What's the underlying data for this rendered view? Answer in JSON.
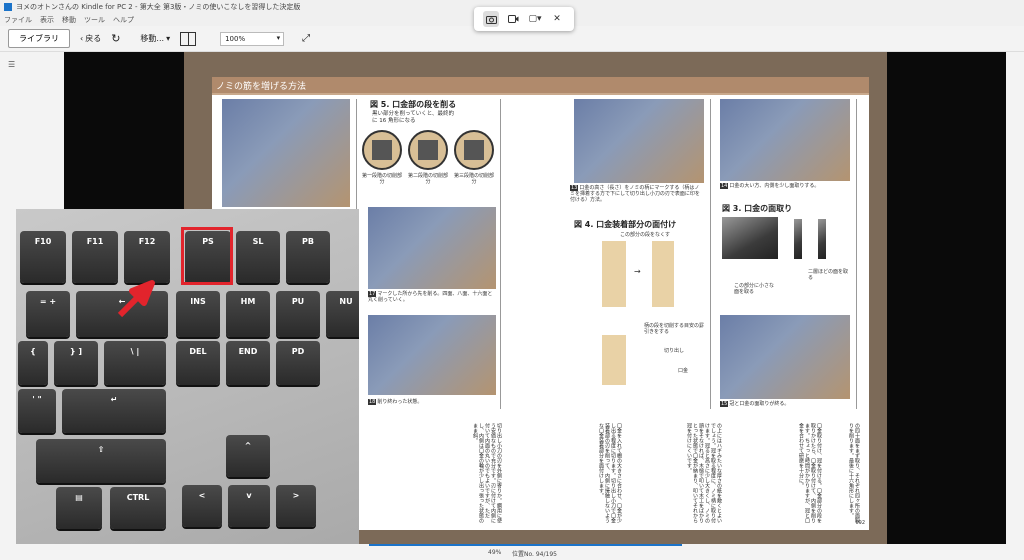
{
  "window": {
    "title": "ヨメのオトンさんの Kindle for PC 2 - 第大全 第3版・ノミの使いこなしを習得した決定版"
  },
  "menu": [
    "ファイル",
    "表示",
    "移動",
    "ツール",
    "ヘルプ"
  ],
  "toolbar": {
    "library": "ライブラリ",
    "back": "戻る",
    "go": "移動...",
    "zoom": "100%"
  },
  "capture_tools": [
    "camera-icon",
    "video-icon",
    "window-capture-icon",
    "close-icon"
  ],
  "page": {
    "header": "ノミの筋を増げる方法",
    "fig5_title": "図 5. 口金部の段を削る",
    "fig5_sub": "黒い部分を削っていくと、最終的に 16 角形になる",
    "circles": [
      "第一段階の切削部分",
      "第二段階の切削部分",
      "第三段階の切削部分"
    ],
    "cap17": "マークした所から先を削る。四面、八面、十六面と丸く削っていく。",
    "cap18": "削り終わった状態。",
    "cap13": "口金の高さ（長さ）をノミの柄にマークする（柄はノミを挿着する方で下にして切り出し小刀の刃で表面に印を付ける）方法。",
    "fig4_title": "図 4. 口金装着部分の面付け",
    "fig4_label": "この部分の段をなくす",
    "fig4_label2": "柄の段を切削する目安の罫引きをする",
    "fig4_label3": "切り出し",
    "fig4_label4": "口金",
    "cap14": "口金の大い方、内側を少し面取りする。",
    "fig3_title": "図 3. 口金の面取り",
    "fig3_label": "二層ほどの面を取る",
    "fig3_label2": "この部分に小さな面を取る",
    "cap15": "冠と口金の面取りが終る。",
    "text1": "切り出し小刀の刃を外側に寄りか。鋼用に使う安価なもので充分です。刃に付けて内側に付いて内面の丸いのでもよいですが、ただし、内側は口金の輪が少し出っ張った状態のまま斜。",
    "text2": "口金を入れて棚の大きさに合わせ、口金が少し出る程度に切ります。切り出し小刀で口金装着部の刃を削って、内側に接触しないような口金装着部分を面付けします。",
    "text3": "の上にはハギみたいな厚さの紙を敷くとよいでしょう。冠を取る程度に、ノミ柄に取り付けます。冠ると高さに少し大きくし、ノミの頭をそなければ、木槌で叩いて木工をばかりとった状態で口金が納まり、叩いてそれから冠を付けにくいです。",
    "text4": "口金取り付け、冠を付ける。口金部分の段を取りかけたら、口金取り付けて、内側を削ります。ちょっと時間がかかりますが、冠と口金を合わせて研磨を十分に。",
    "text5": "の四十面をまず取り、それぞれ四ヶ所の面取りを削ります。最後に十六角形にします。",
    "pagenum": "092"
  },
  "keyboard": {
    "row1": [
      "F10",
      "F11",
      "F12",
      "PS",
      "SL",
      "PB"
    ],
    "row2": [
      "= +",
      "←",
      "INS",
      "HM",
      "PU",
      "NU"
    ],
    "row3": [
      "{",
      "} ]",
      "\\ |",
      "DEL",
      "END",
      "PD"
    ],
    "row4": [
      "' \"",
      "↵"
    ],
    "row5": [
      "⇧",
      "^"
    ],
    "row6": [
      "▤",
      "CTRL",
      "<",
      "v",
      ">"
    ]
  },
  "status": {
    "percent": "49%",
    "location": "位置No. 94/195"
  },
  "colors": {
    "accent": "#1b73c9",
    "highlight": "#e2242c",
    "header": "#b08a6c"
  }
}
